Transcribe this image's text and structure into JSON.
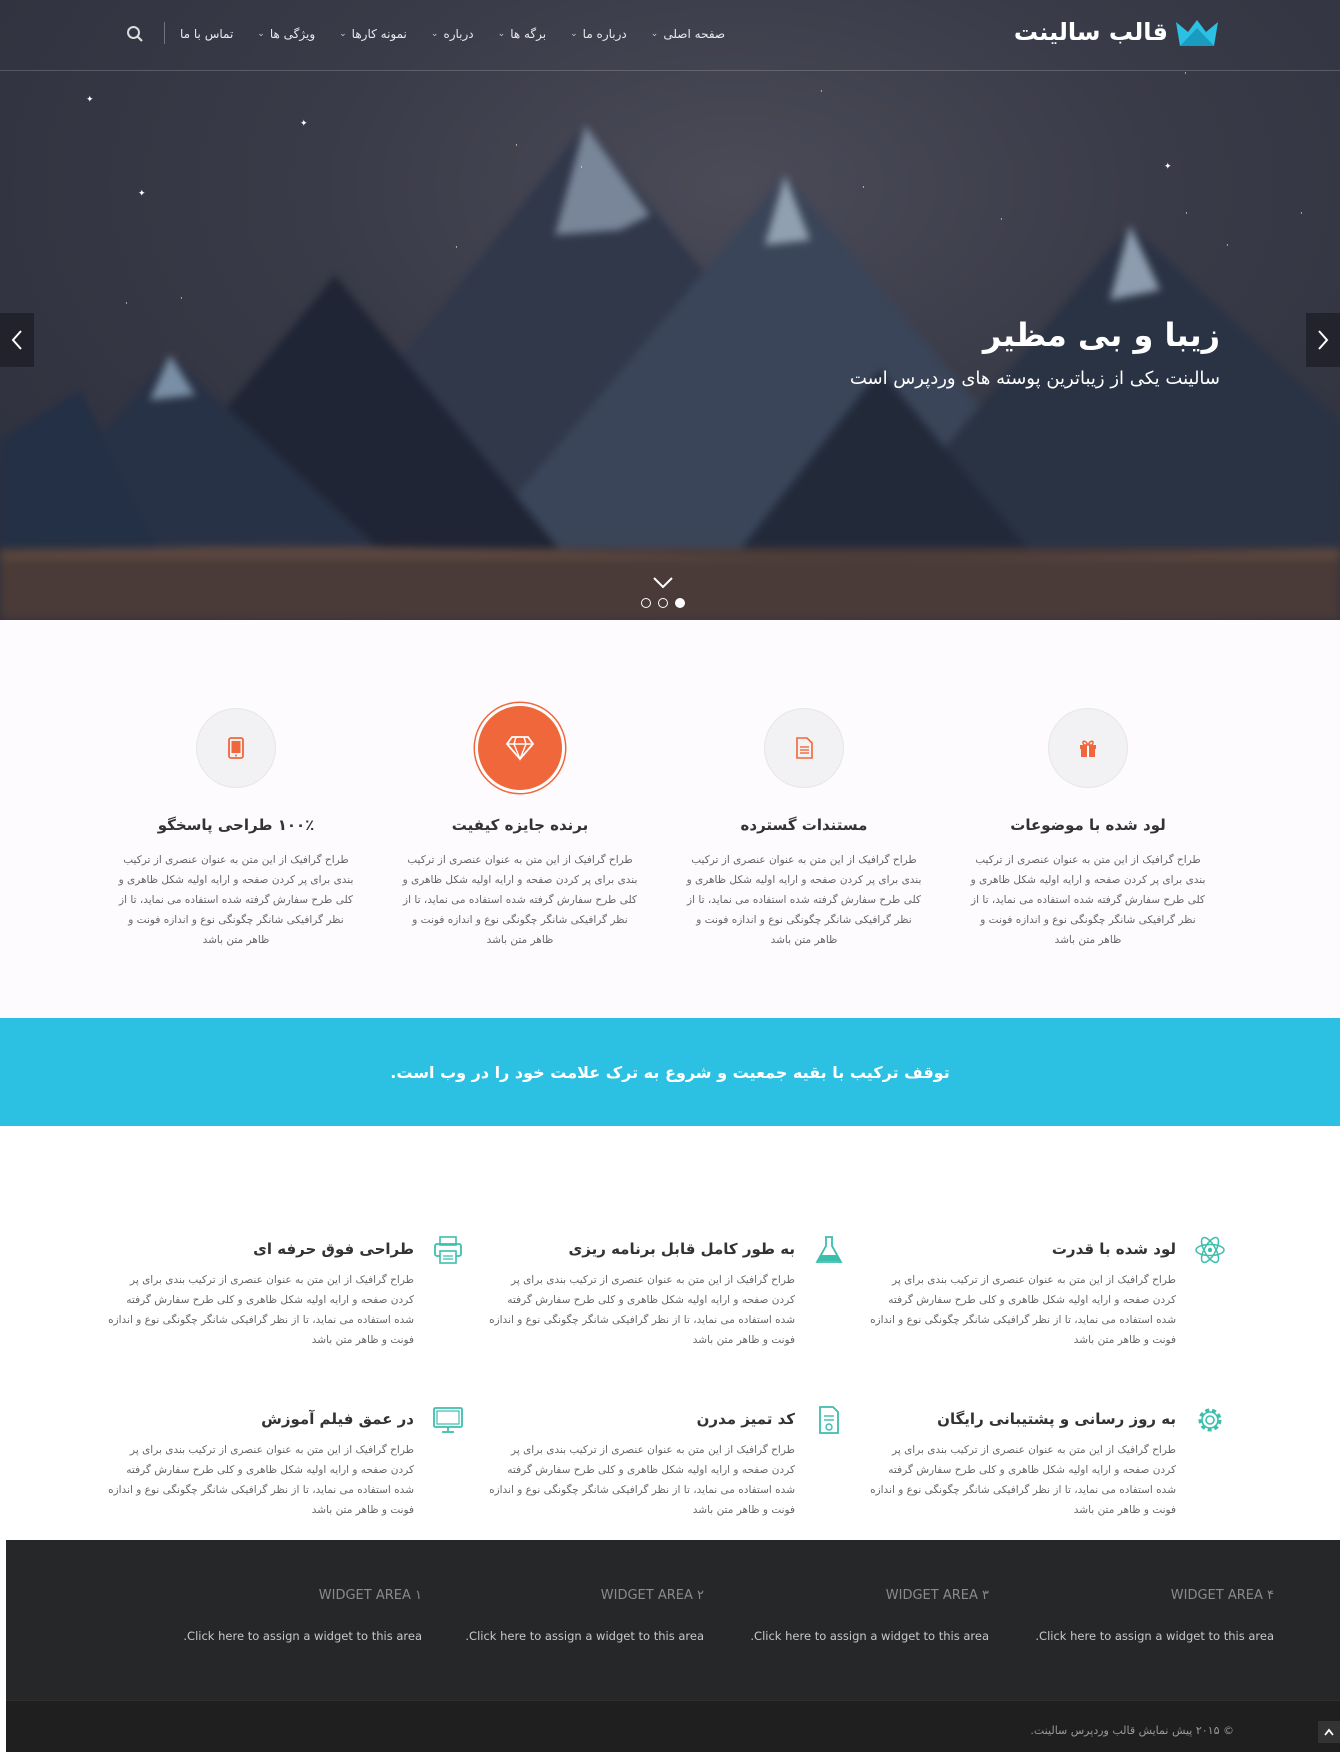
{
  "header": {
    "logo_text": "قالب سالینت",
    "nav": [
      {
        "label": "صفحه اصلی"
      },
      {
        "label": "درباره ما"
      },
      {
        "label": "برگه ها"
      },
      {
        "label": "درباره"
      },
      {
        "label": "نمونه کارها"
      },
      {
        "label": "ویژگی ها"
      },
      {
        "label": "تماس با ما"
      }
    ]
  },
  "hero": {
    "title": "زیبا و بی مظیر",
    "subtitle": "سالینت یکی از زیباترین پوسته های وردپرس است",
    "slides_total": 3,
    "active_slide": 3
  },
  "features": [
    {
      "title": "لود شده با موضوعات",
      "icon": "gift-icon",
      "text": "طراح گرافیک از این متن به عنوان عنصری از ترکیب بندی برای پر کردن صفحه و ارایه اولیه شکل ظاهری و کلی طرح سفارش گرفته شده استفاده می نماید، تا از نظر گرافیکی شانگر چگونگی نوع و اندازه فونت و ظاهر متن باشد"
    },
    {
      "title": "مستندات گسترده",
      "icon": "document-icon",
      "text": "طراح گرافیک از این متن به عنوان عنصری از ترکیب بندی برای پر کردن صفحه و ارایه اولیه شکل ظاهری و کلی طرح سفارش گرفته شده استفاده می نماید، تا از نظر گرافیکی شانگر چگونگی نوع و اندازه فونت و ظاهر متن باشد"
    },
    {
      "title": "برنده جایزه کیفیت",
      "icon": "diamond-icon",
      "text": "طراح گرافیک از این متن به عنوان عنصری از ترکیب بندی برای پر کردن صفحه و ارایه اولیه شکل ظاهری و کلی طرح سفارش گرفته شده استفاده می نماید، تا از نظر گرافیکی شانگر چگونگی نوع و اندازه فونت و ظاهر متن باشد"
    },
    {
      "title": "۱۰۰٪ طراحی پاسخگو",
      "icon": "tablet-icon",
      "text": "طراح گرافیک از این متن به عنوان عنصری از ترکیب بندی برای پر کردن صفحه و ارایه اولیه شکل ظاهری و کلی طرح سفارش گرفته شده استفاده می نماید، تا از نظر گرافیکی شانگر چگونگی نوع و اندازه فونت و ظاهر متن باشد"
    }
  ],
  "banner": {
    "text": "توقف ترکیب با بقیه جمعیت و شروع به ترک علامت خود را در وب است."
  },
  "services": [
    {
      "title": "لود شده با قدرت",
      "icon": "atom-icon",
      "text": "طراح گرافیک از این متن به عنوان عنصری از ترکیب بندی برای پر کردن صفحه و ارایه اولیه شکل ظاهری و کلی طرح سفارش گرفته شده استفاده می نماید، تا از نظر گرافیکی شانگر چگونگی نوع و اندازه فونت و ظاهر متن باشد"
    },
    {
      "title": "به طور کامل قابل برنامه ریزی",
      "icon": "flask-icon",
      "text": "طراح گرافیک از این متن به عنوان عنصری از ترکیب بندی برای پر کردن صفحه و ارایه اولیه شکل ظاهری و کلی طرح سفارش گرفته شده استفاده می نماید، تا از نظر گرافیکی شانگر چگونگی نوع و اندازه فونت و ظاهر متن باشد"
    },
    {
      "title": "طراحی فوق حرفه ای",
      "icon": "printer-icon",
      "text": "طراح گرافیک از این متن به عنوان عنصری از ترکیب بندی برای پر کردن صفحه و ارایه اولیه شکل ظاهری و کلی طرح سفارش گرفته شده استفاده می نماید، تا از نظر گرافیکی شانگر چگونگی نوع و اندازه فونت و ظاهر متن باشد"
    },
    {
      "title": "به روز رسانی و پشتیبانی رایگان",
      "icon": "gear-icon",
      "text": "طراح گرافیک از این متن به عنوان عنصری از ترکیب بندی برای پر کردن صفحه و ارایه اولیه شکل ظاهری و کلی طرح سفارش گرفته شده استفاده می نماید، تا از نظر گرافیکی شانگر چگونگی نوع و اندازه فونت و ظاهر متن باشد"
    },
    {
      "title": "کد تمیز مدرن",
      "icon": "code-file-icon",
      "text": "طراح گرافیک از این متن به عنوان عنصری از ترکیب بندی برای پر کردن صفحه و ارایه اولیه شکل ظاهری و کلی طرح سفارش گرفته شده استفاده می نماید، تا از نظر گرافیکی شانگر چگونگی نوع و اندازه فونت و ظاهر متن باشد"
    },
    {
      "title": "در عمق فیلم آموزش",
      "icon": "monitor-icon",
      "text": "طراح گرافیک از این متن به عنوان عنصری از ترکیب بندی برای پر کردن صفحه و ارایه اولیه شکل ظاهری و کلی طرح سفارش گرفته شده استفاده می نماید، تا از نظر گرافیکی شانگر چگونگی نوع و اندازه فونت و ظاهر متن باشد"
    }
  ],
  "widgets": [
    {
      "title": "WIDGET AREA ۴",
      "link": ".Click here to assign a widget to this area"
    },
    {
      "title": "WIDGET AREA ۳",
      "link": ".Click here to assign a widget to this area"
    },
    {
      "title": "WIDGET AREA ۲",
      "link": ".Click here to assign a widget to this area"
    },
    {
      "title": "WIDGET AREA ۱",
      "link": ".Click here to assign a widget to this area"
    }
  ],
  "footer": {
    "copyright": "© ۲۰۱۵ پیش نمایش قالب وردپرس سالینت."
  },
  "colors": {
    "accent_orange": "#f0673b",
    "accent_cyan": "#2cc0e3",
    "teal_icon": "#3bbfad",
    "footer_dark": "#262728"
  }
}
